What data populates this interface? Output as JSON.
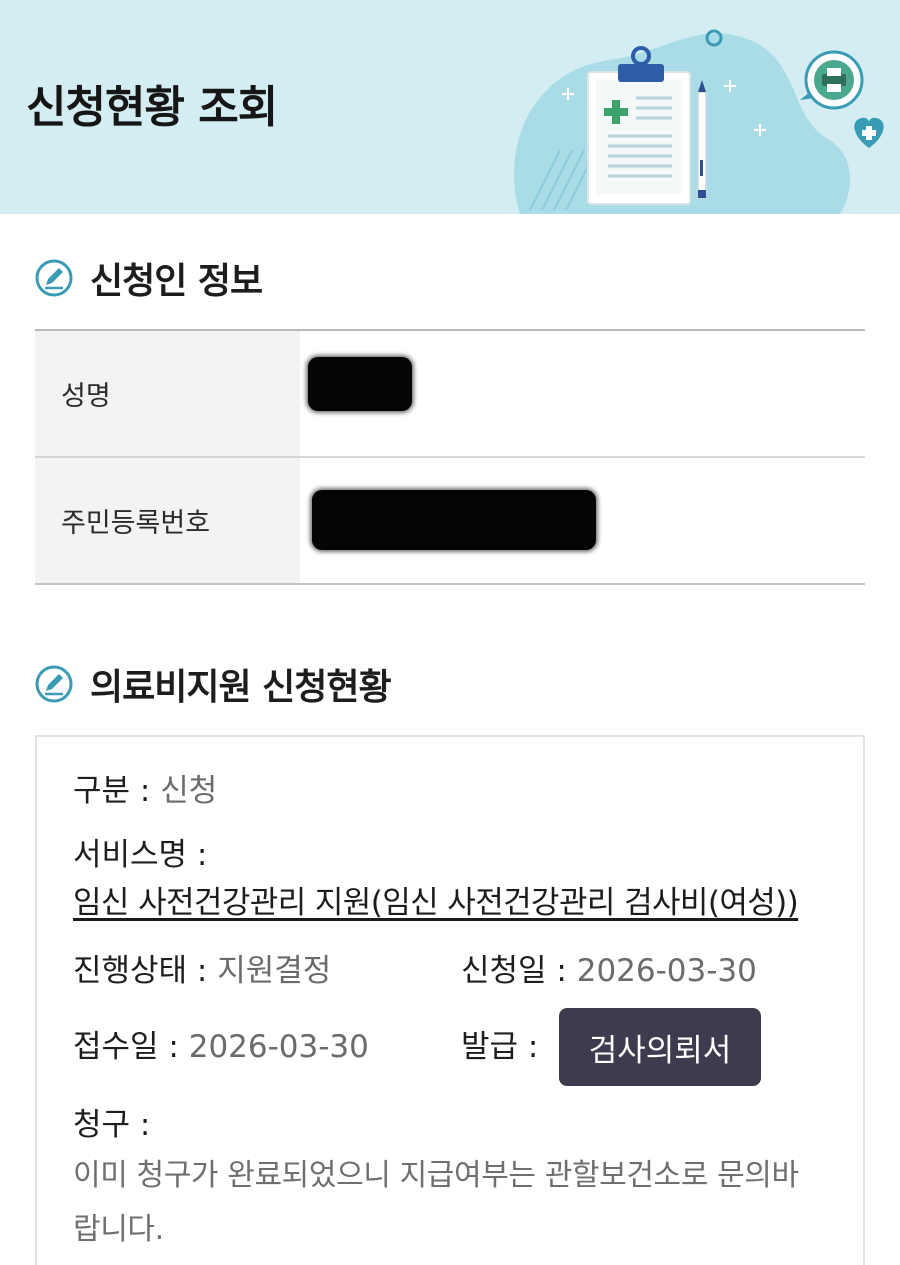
{
  "header": {
    "title": "신청현황 조회"
  },
  "applicant_section": {
    "heading": "신청인 정보",
    "rows": [
      {
        "label": "성명",
        "value_redacted": true
      },
      {
        "label": "주민등록번호",
        "value_redacted": true
      }
    ]
  },
  "status_section": {
    "heading": "의료비지원 신청현황",
    "category_label": "구분 :",
    "category_value": "신청",
    "service_label": "서비스명 :",
    "service_name": "임신 사전건강관리 지원(임신 사전건강관리 검사비(여성))",
    "progress_label": "진행상태 :",
    "progress_value": "지원결정",
    "apply_date_label": "신청일 :",
    "apply_date_value": "2026-03-30",
    "receipt_date_label": "접수일 :",
    "receipt_date_value": "2026-03-30",
    "issue_label": "발급 :",
    "issue_button": "검사의뢰서",
    "claim_label": "청구 :",
    "claim_message": "이미 청구가 완료되었으니 지급여부는 관할보건소로 문의바랍니다."
  },
  "colors": {
    "banner_bg": "#d3edf2",
    "button_bg": "#3c3c4e",
    "icon_accent": "#3a9bb5"
  },
  "icons": [
    "clipboard-illustration",
    "pencil-icon",
    "printer-bubble-icon",
    "heart-plus-icon",
    "edit-circle-icon"
  ]
}
